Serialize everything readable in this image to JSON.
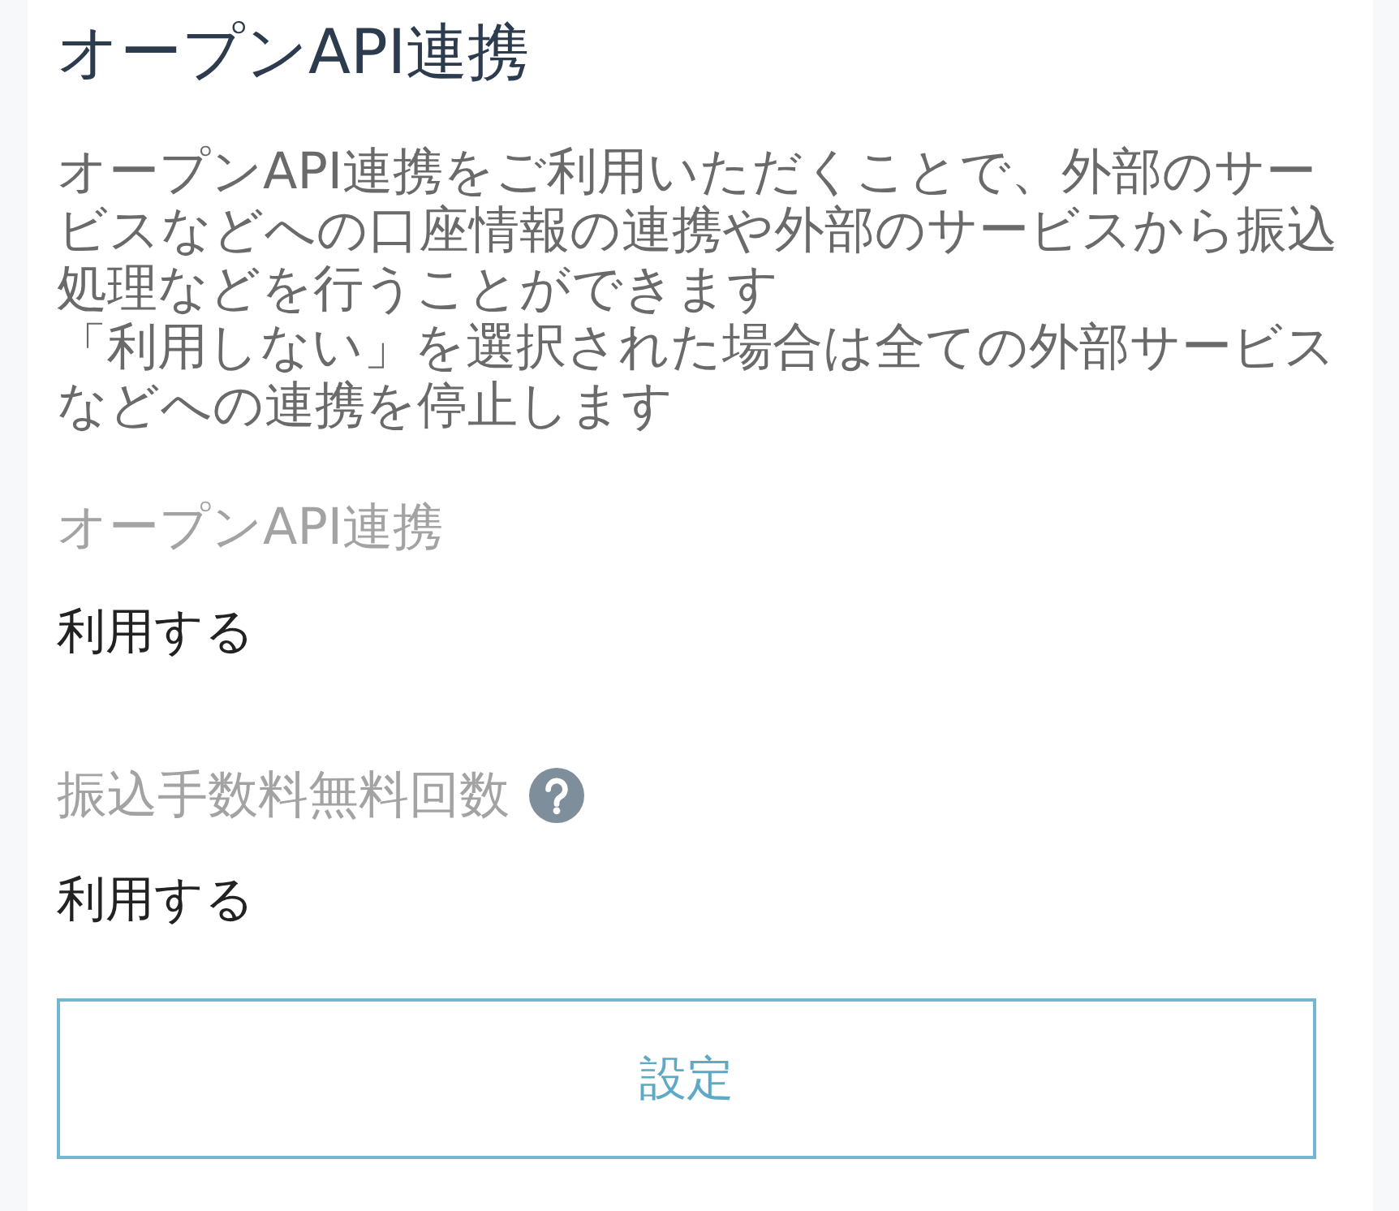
{
  "page": {
    "title": "オープンAPI連携",
    "description": [
      "オープンAPI連携をご利用いただくことで、外部のサービスなどへの口座情報の連携や外部のサービスから振込処理などを行うことができます",
      "「利用しない」を選択された場合は全ての外部サービスなどへの連携を停止します"
    ]
  },
  "settings": [
    {
      "label": "オープンAPI連携",
      "value": "利用する",
      "help": false
    },
    {
      "label": "振込手数料無料回数",
      "value": "利用する",
      "help": true
    }
  ],
  "buttons": [
    {
      "label": "設定"
    }
  ]
}
